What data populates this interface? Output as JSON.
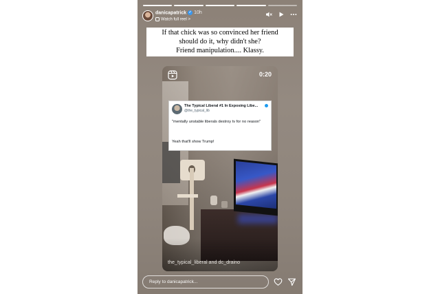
{
  "story": {
    "username": "danicapatrick",
    "time": "10h",
    "watch_label": "Watch full reel",
    "watch_arrow": ">",
    "progress": {
      "segments": 5,
      "completed": 4
    },
    "caption_lines": [
      "If that chick was so convinced her friend",
      "should do it, why didn't she?",
      "Friend manipulation.... Klassy."
    ]
  },
  "reel": {
    "duration": "0:20",
    "credit": "the_typical_liberal and dc_draino"
  },
  "tweet": {
    "name": "The Typical Liberal #1 In Exposing Libe...",
    "handle": "@the_typical_lib",
    "body": "\"mentally unstable liberals destroy tv for no reason\"",
    "body2": "Yeah that'll show Trump!"
  },
  "footer": {
    "reply_placeholder": "Reply to danicapatrick..."
  },
  "icons": {
    "verified": "verified-badge-icon",
    "mute": "speaker-muted-icon",
    "play": "play-icon",
    "more": "more-horizontal-icon",
    "reels": "reels-icon",
    "like": "heart-icon",
    "share": "send-icon"
  },
  "colors": {
    "verified_blue": "#3897f0",
    "caption_bg": "#ffffff"
  }
}
